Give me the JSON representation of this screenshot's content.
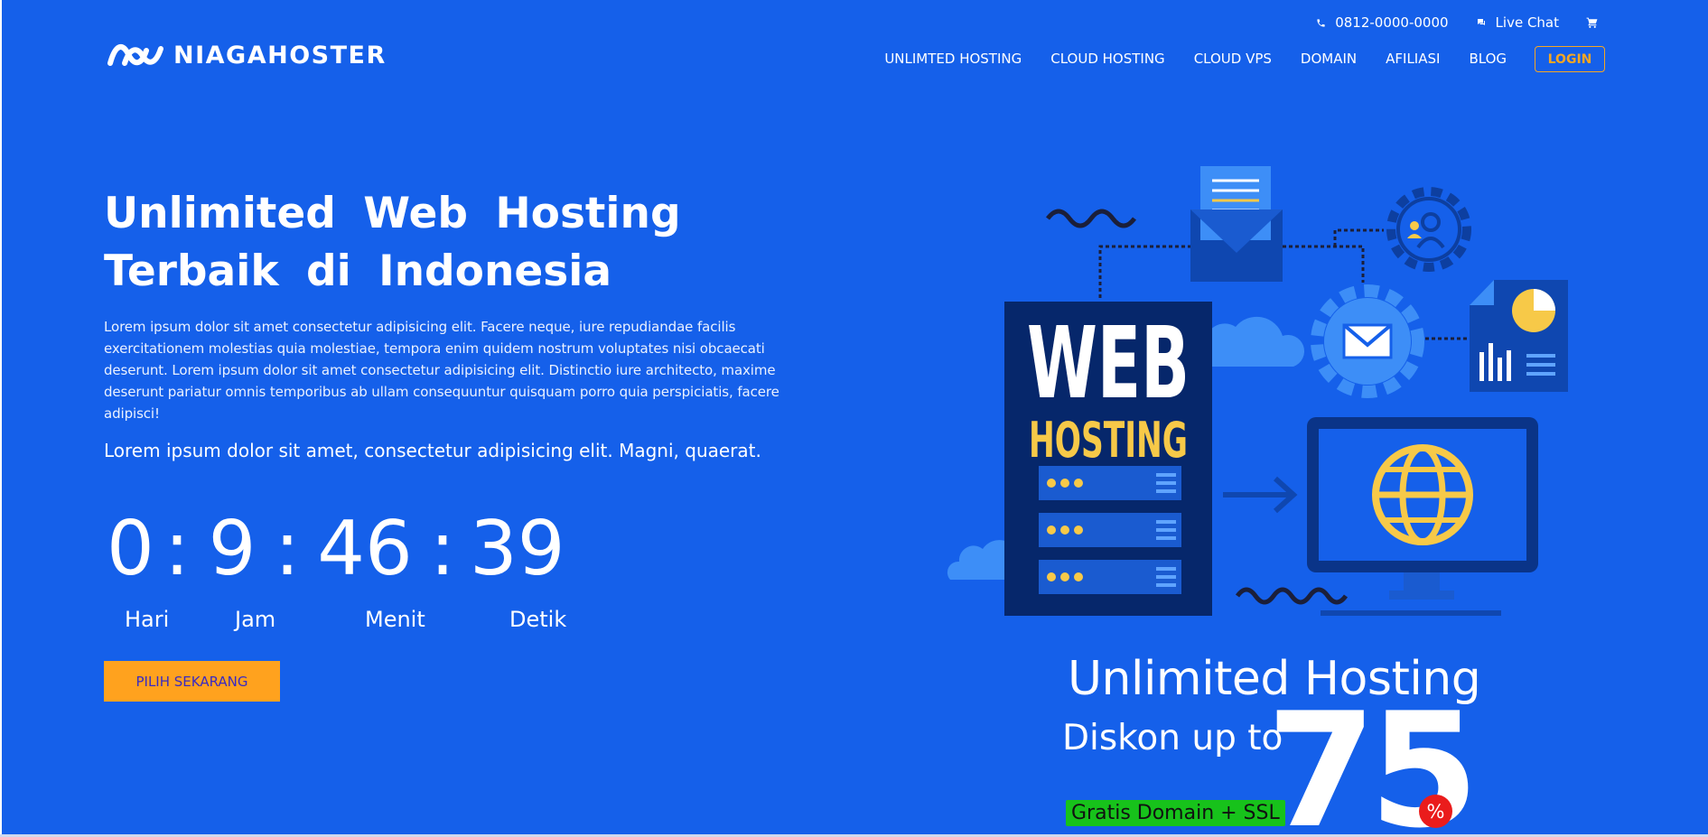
{
  "colors": {
    "background": "#1560ea",
    "accent": "#ffa21e",
    "login_border": "#f5a623",
    "badge_green": "#17c21b",
    "badge_red": "#ea1c1c"
  },
  "topbar": {
    "phone_icon": "phone-icon",
    "phone": "0812-0000-0000",
    "chat_icon": "chat-bubble-icon",
    "chat_label": "Live Chat",
    "cart_icon": "shopping-cart-icon"
  },
  "brand": {
    "logo_icon": "niagahoster-wave-icon",
    "name": "NIAGAHOSTER"
  },
  "nav": {
    "items": [
      "UNLIMTED HOSTING",
      "CLOUD HOSTING",
      "CLOUD VPS",
      "DOMAIN",
      "AFILIASI",
      "BLOG"
    ],
    "login": "LOGIN"
  },
  "hero": {
    "headline_line1": "Unlimited Web Hosting",
    "headline_line2": "Terbaik di Indonesia",
    "description": "Lorem ipsum dolor sit amet consectetur adipisicing elit. Facere neque, iure repudiandae facilis exercitationem molestias quia molestiae, tempora enim quidem nostrum voluptates nisi obcaecati deserunt. Lorem ipsum dolor sit amet consectetur adipisicing elit. Distinctio iure architecto, maxime deserunt pariatur omnis temporibus ab ullam consequuntur quisquam porro quia perspiciatis, facere adipisci!",
    "subtext": "Lorem ipsum dolor sit amet, consectetur adipisicing elit. Magni, quaerat.",
    "countdown": {
      "days": "0",
      "hours": "9",
      "minutes": "46",
      "seconds": "39",
      "separator": ":",
      "labels": {
        "days": "Hari",
        "hours": "Jam",
        "minutes": "Menit",
        "seconds": "Detik"
      }
    },
    "cta": "PILIH SEKARANG"
  },
  "illustration": {
    "server_title": "WEB",
    "server_subtitle": "HOSTING",
    "promo_title": "Unlimited Hosting",
    "promo_discount": "Diskon up to",
    "promo_number": "75",
    "promo_percent": "%",
    "promo_badge": "Gratis Domain + SSL"
  }
}
